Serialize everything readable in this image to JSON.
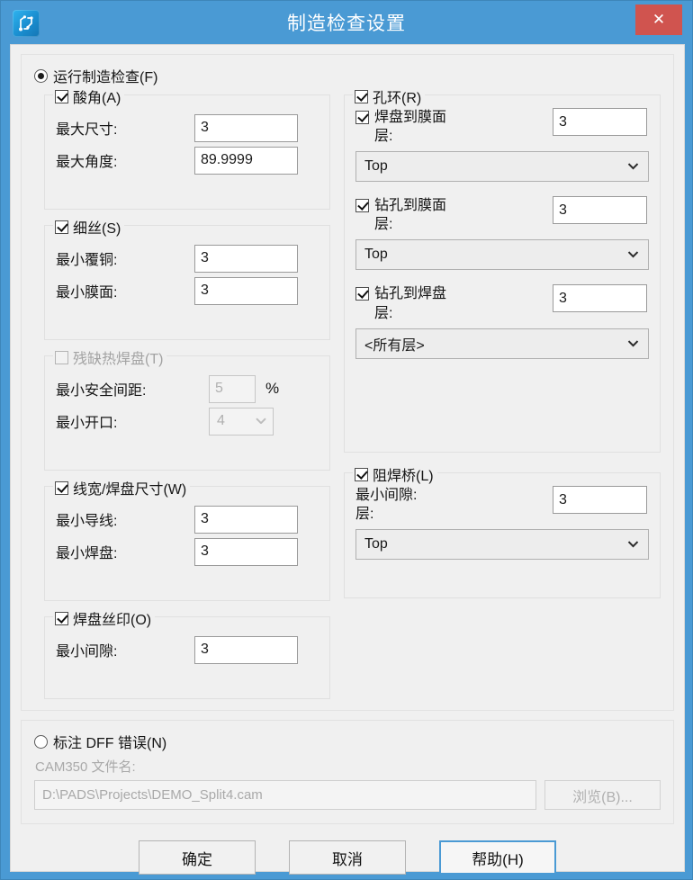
{
  "window": {
    "title": "制造检查设置",
    "icon": "pcb-trace-icon",
    "close_label": "✕",
    "accent_color": "#4a9ad4",
    "close_color": "#d0544f"
  },
  "main": {
    "run_check": {
      "label": "运行制造检查(F)",
      "selected": true
    },
    "left_groups": [
      {
        "title": "酸角(A)",
        "checked": true,
        "enabled": true,
        "fields": [
          {
            "label": "最大尺寸:",
            "value": "3"
          },
          {
            "label": "最大角度:",
            "value": "89.9999"
          }
        ]
      },
      {
        "title": "细丝(S)",
        "checked": true,
        "enabled": true,
        "fields": [
          {
            "label": "最小覆铜:",
            "value": "3"
          },
          {
            "label": "最小膜面:",
            "value": "3"
          }
        ]
      },
      {
        "title": "残缺热焊盘(T)",
        "checked": false,
        "enabled": false,
        "fields": [
          {
            "label": "最小安全间距:",
            "value": "5",
            "suffix": "%"
          },
          {
            "label": "最小开口:",
            "value": "4",
            "type": "combo"
          }
        ]
      },
      {
        "title": "线宽/焊盘尺寸(W)",
        "checked": true,
        "enabled": true,
        "fields": [
          {
            "label": "最小导线:",
            "value": "3"
          },
          {
            "label": "最小焊盘:",
            "value": "3"
          }
        ]
      },
      {
        "title": "焊盘丝印(O)",
        "checked": true,
        "enabled": true,
        "fields": [
          {
            "label": "最小间隙:",
            "value": "3"
          }
        ]
      }
    ],
    "right_groups": [
      {
        "title": "孔环(R)",
        "checked": true,
        "enabled": true,
        "blocks": [
          {
            "label": "焊盘到膜面",
            "checked": true,
            "value": "3",
            "layer_label": "层:",
            "layer_value": "Top"
          },
          {
            "label": "钻孔到膜面",
            "checked": true,
            "value": "3",
            "layer_label": "层:",
            "layer_value": "Top"
          },
          {
            "label": "钻孔到焊盘",
            "checked": true,
            "value": "3",
            "layer_label": "层:",
            "layer_value": "<所有层>"
          }
        ]
      },
      {
        "title": "阻焊桥(L)",
        "checked": true,
        "enabled": true,
        "blocks": [
          {
            "label": "最小间隙:",
            "checked": null,
            "value": "3",
            "layer_label": "层:",
            "layer_value": "Top"
          }
        ]
      }
    ],
    "dff": {
      "label": "标注 DFF 错误(N)",
      "selected": false,
      "sub_label": "CAM350 文件名:",
      "path_value": "D:\\PADS\\Projects\\DEMO_Split4.cam",
      "browse_label": "浏览(B)..."
    }
  },
  "footer": {
    "ok_label": "确定",
    "cancel_label": "取消",
    "help_label": "帮助(H)"
  }
}
